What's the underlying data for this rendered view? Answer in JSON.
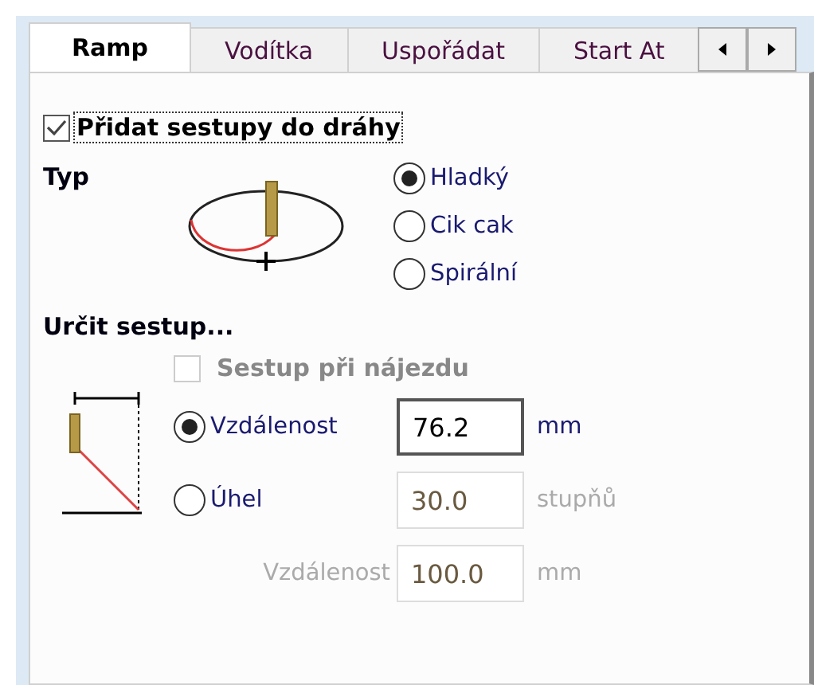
{
  "tabs": [
    {
      "label": "Ramp",
      "selected": true
    },
    {
      "label": "Vodítka",
      "selected": false
    },
    {
      "label": "Uspořádat",
      "selected": false
    },
    {
      "label": "Start At",
      "selected": false
    }
  ],
  "add_ramps": {
    "label": "Přidat sestupy do dráhy",
    "checked": true
  },
  "type": {
    "label": "Typ",
    "options": [
      {
        "label": "Hladký",
        "selected": true
      },
      {
        "label": "Cik cak",
        "selected": false
      },
      {
        "label": "Spirální",
        "selected": false
      }
    ]
  },
  "define": {
    "label": "Určit sestup...",
    "lead_in": {
      "label": "Sestup při nájezdu",
      "checked": false,
      "disabled": true
    },
    "modes": [
      {
        "label": "Vzdálenost",
        "selected": true,
        "value": "76.2",
        "unit": "mm",
        "disabled": false
      },
      {
        "label": "Úhel",
        "selected": false,
        "value": "30.0",
        "unit": "stupňů",
        "disabled": true
      }
    ],
    "extra": {
      "label": "Vzdálenost",
      "value": "100.0",
      "unit": "mm",
      "disabled": true
    }
  }
}
